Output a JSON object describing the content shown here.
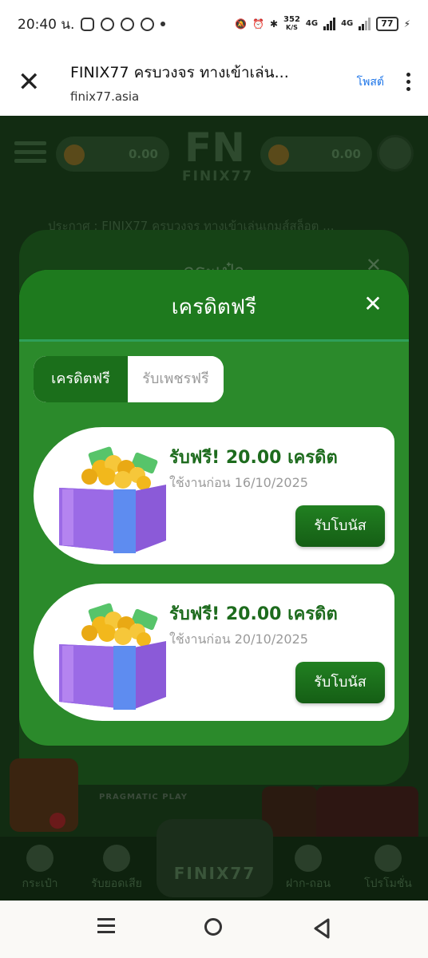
{
  "status_bar": {
    "time": "20:40 น.",
    "net_speed_value": "352",
    "net_speed_unit": "K/S",
    "net_type_1": "4G",
    "net_type_2": "4G",
    "battery": "77"
  },
  "browser": {
    "page_title": "FINIX77 ครบวงจร ทางเข้าเล่น...",
    "url": "finix77.asia",
    "share_label": "โพสต์"
  },
  "background_page": {
    "wallet_left_amount": "0.00",
    "wallet_right_amount": "0.00",
    "logo_monogram": "FN",
    "logo_text": "FINIX77",
    "marquee_text": "ประกาศ : FINIX77 ครบวงจร ทางเข้าเล่นเกมส์สล็อต ...",
    "wallet_modal_title": "กระเป๋า",
    "provider_label": "PRAGMATIC PLAY",
    "bottom_nav": [
      {
        "label": "กระเป๋า"
      },
      {
        "label": "รับยอดเสีย"
      },
      {
        "label": "FINIX77"
      },
      {
        "label": "ฝาก-ถอน"
      },
      {
        "label": "โปรโมชั่น"
      }
    ]
  },
  "credit_modal": {
    "title": "เครดิตฟรี",
    "tabs": [
      {
        "label": "เครดิตฟรี",
        "active": true
      },
      {
        "label": "รับเพชรฟรี",
        "active": false
      }
    ],
    "cards": [
      {
        "title": "รับฟรี! 20.00 เครดิต",
        "expiry": "ใช้งานก่อน 16/10/2025",
        "button": "รับโบนัส"
      },
      {
        "title": "รับฟรี! 20.00 เครดิต",
        "expiry": "ใช้งานก่อน 20/10/2025",
        "button": "รับโบนัส"
      }
    ]
  },
  "colors": {
    "modal_green": "#2b8a2b",
    "header_green": "#1e7a1e",
    "title_green": "#1d6b1d",
    "button_green": "#155e15"
  }
}
